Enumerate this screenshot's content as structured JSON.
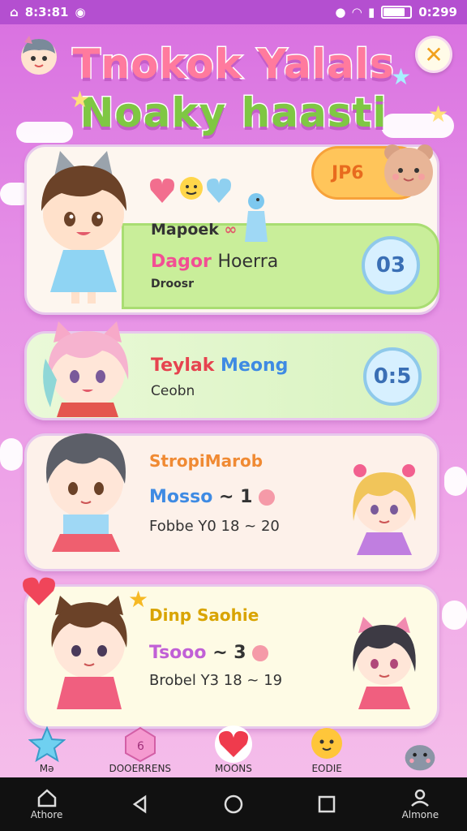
{
  "status_bar": {
    "time_left": "8:3:81",
    "time_right": "0:299"
  },
  "header": {
    "title_line_1": "Tnokok Yalals",
    "title_line_2": "Noaky haasti",
    "close_label": "✕"
  },
  "cards": [
    {
      "badge_pill": "JP6",
      "line_1": "Mapoek",
      "line_1_suffix": "∞",
      "line_2_a": "Dagor",
      "line_2_b": "Hoerra",
      "line_3": "Droosr",
      "round_badge": "03"
    },
    {
      "name_a": "Teylak",
      "name_b": "Meong",
      "line_2": "Ceobn",
      "round_badge": "0:5"
    },
    {
      "name": "StropiMarob",
      "line_2_a": "Mosso",
      "line_2_b": "~ 1",
      "line_3": "Fobbe Y0 18 ~ 20"
    },
    {
      "name": "Dinp Saohie",
      "line_2_a": "Tsooo",
      "line_2_b": "~ 3",
      "line_3": "Brobel Y3 18 ~ 19"
    }
  ],
  "tab_bar": [
    {
      "label": "Mə"
    },
    {
      "label": "DOOERRENS"
    },
    {
      "label": "MOONS"
    },
    {
      "label": "EODIE"
    },
    {
      "label": ""
    }
  ],
  "nav_bar": {
    "home_label": "Athore",
    "profile_label": "Almone"
  },
  "colors": {
    "status_bar": "#b44fd0",
    "title_pink": "#ff7a9e",
    "title_green": "#7fc743",
    "badge_orange": "#ffc55a"
  }
}
